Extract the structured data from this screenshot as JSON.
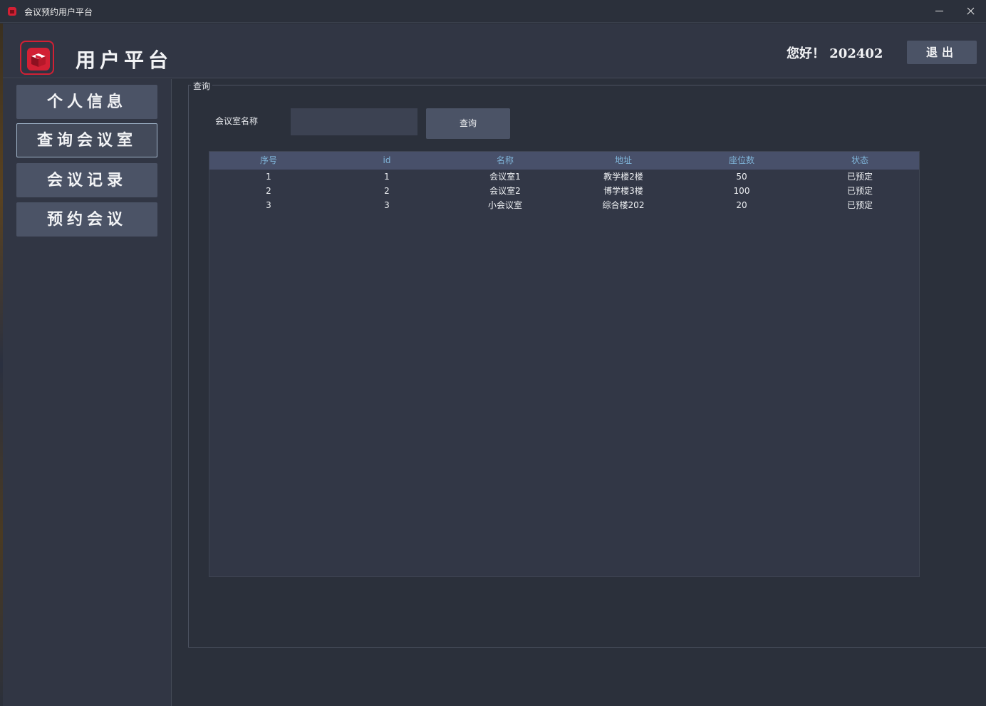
{
  "window": {
    "title": "会议预约用户平台"
  },
  "header": {
    "title": "用户平台",
    "greeting": "您好！ 202402",
    "logout_label": "退出"
  },
  "sidebar": {
    "items": [
      {
        "label": "个人信息"
      },
      {
        "label": "查询会议室",
        "active": true
      },
      {
        "label": "会议记录"
      },
      {
        "label": "预约会议"
      }
    ]
  },
  "query": {
    "legend": "查询",
    "room_name_label": "会议室名称",
    "room_name_value": "",
    "query_button": "查询"
  },
  "table": {
    "headers": [
      "序号",
      "id",
      "名称",
      "地址",
      "座位数",
      "状态"
    ],
    "rows": [
      [
        "1",
        "1",
        "会议室1",
        "教学楼2楼",
        "50",
        "已预定"
      ],
      [
        "2",
        "2",
        "会议室2",
        "博学楼3楼",
        "100",
        "已预定"
      ],
      [
        "3",
        "3",
        "小会议室",
        "综合楼202",
        "20",
        "已预定"
      ]
    ]
  },
  "colors": {
    "accent_red": "#d22034",
    "header_text": "#7fb4d8",
    "button_bg": "#4b5366"
  }
}
